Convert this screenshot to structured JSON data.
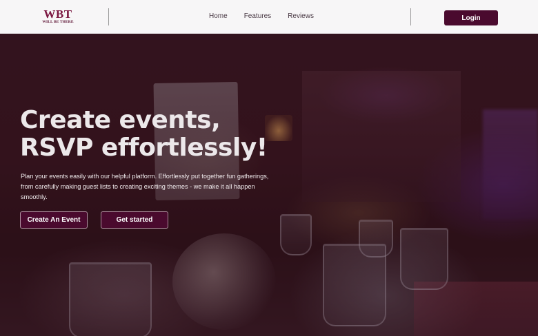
{
  "nav": {
    "logo_mark": "WBT",
    "logo_tagline": "WILL BE THERE",
    "links": [
      "Home",
      "Features",
      "Reviews"
    ],
    "login_label": "Login"
  },
  "hero": {
    "title_line1": "Create events,",
    "title_line2": "RSVP effortlessly!",
    "description": "Plan your events easily with our helpful platform. Effortlessly put together fun gatherings, from carefully making guest lists to creating exciting themes - we make it all happen smoothly.",
    "primary_button": "Create An Event",
    "secondary_button": "Get started"
  },
  "colors": {
    "brand": "#4a0a2e",
    "logo": "#7a1540",
    "nav_background": "#f7f6f7"
  }
}
